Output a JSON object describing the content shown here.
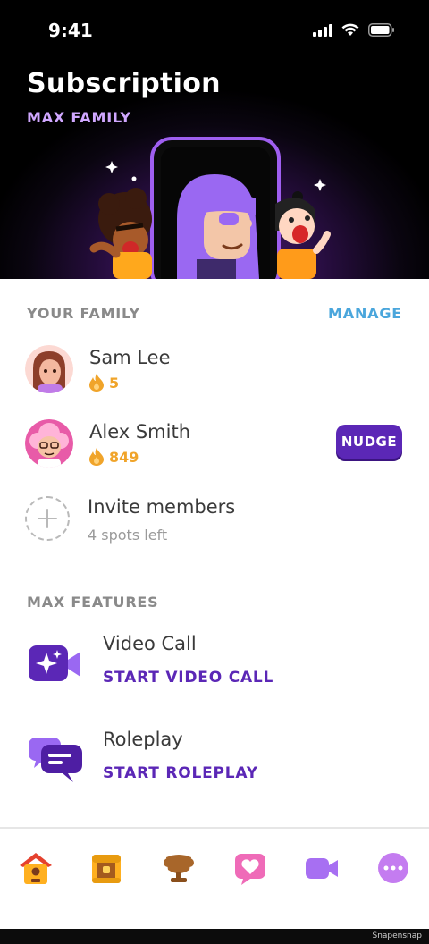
{
  "status_bar": {
    "time": "9:41"
  },
  "header": {
    "title": "Subscription",
    "subtitle": "MAX FAMILY"
  },
  "family": {
    "section_label": "YOUR FAMILY",
    "manage_label": "MANAGE",
    "members": [
      {
        "name": "Sam Lee",
        "streak": "5"
      },
      {
        "name": "Alex Smith",
        "streak": "849",
        "action_label": "NUDGE"
      }
    ],
    "invite": {
      "title": "Invite members",
      "subtitle": "4 spots left"
    }
  },
  "features": {
    "section_label": "MAX FEATURES",
    "items": [
      {
        "title": "Video Call",
        "cta": "START VIDEO CALL",
        "icon": "video-sparkle-icon"
      },
      {
        "title": "Roleplay",
        "cta": "START ROLEPLAY",
        "icon": "chat-bubbles-icon"
      }
    ]
  },
  "tabbar": {
    "items": [
      {
        "icon": "home-icon"
      },
      {
        "icon": "treasure-chest-icon"
      },
      {
        "icon": "trophy-icon"
      },
      {
        "icon": "heart-chat-icon"
      },
      {
        "icon": "video-icon"
      },
      {
        "icon": "more-icon"
      }
    ]
  },
  "colors": {
    "accent_purple": "#5b27b6",
    "manage_blue": "#4aa6dc",
    "streak_orange": "#f0a42a",
    "subtitle_lilac": "#d0a7ff"
  },
  "watermark": "Snapensnap"
}
